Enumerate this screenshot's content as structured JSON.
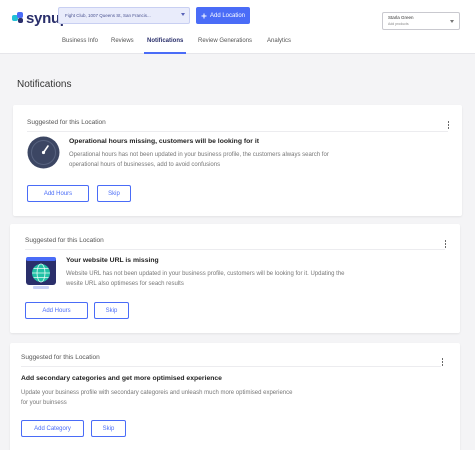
{
  "header": {
    "logo_text": "synup",
    "location_select_value": "Fight Club, 1007 Queens St, San Francis...",
    "add_location_label": "Add Location",
    "add_location_icon": "plus-icon",
    "user_name": "Starla Green",
    "user_subtitle": "Add products"
  },
  "tabs": [
    {
      "label": "Business Info"
    },
    {
      "label": "Reviews"
    },
    {
      "label": "Notifications"
    },
    {
      "label": "Review Generations"
    },
    {
      "label": "Analytics"
    }
  ],
  "page": {
    "title": "Notifications"
  },
  "cards": [
    {
      "heading": "Suggested for this Location",
      "title": "Operational hours missing, customers will be looking for it",
      "description": "Operational hours has not been updated in your business profile, the customers always search for operational hours of businesses, add to avoid confusions",
      "primary_label": "Add Hours",
      "secondary_label": "Skip",
      "icon": "clock-icon"
    },
    {
      "heading": "Suggested for this Location",
      "title": "Your website URL is missing",
      "description": "Website URL has not been updated in your business profile, customers will be looking for it. Updating the wesite URL also optimeses for seach results",
      "primary_label": "Add Hours",
      "secondary_label": "Skip",
      "icon": "globe-icon"
    },
    {
      "heading": "Suggested for this Location",
      "title": "Add secondary categories and get more optimised experience",
      "description": "Update your business profile with secondary categoreis and unleash much more optimised experience for your buinsess",
      "primary_label": "Add Category",
      "secondary_label": "Skip"
    }
  ],
  "colors": {
    "accent": "#4a6cf7",
    "brand_dark": "#2a2f6b"
  }
}
